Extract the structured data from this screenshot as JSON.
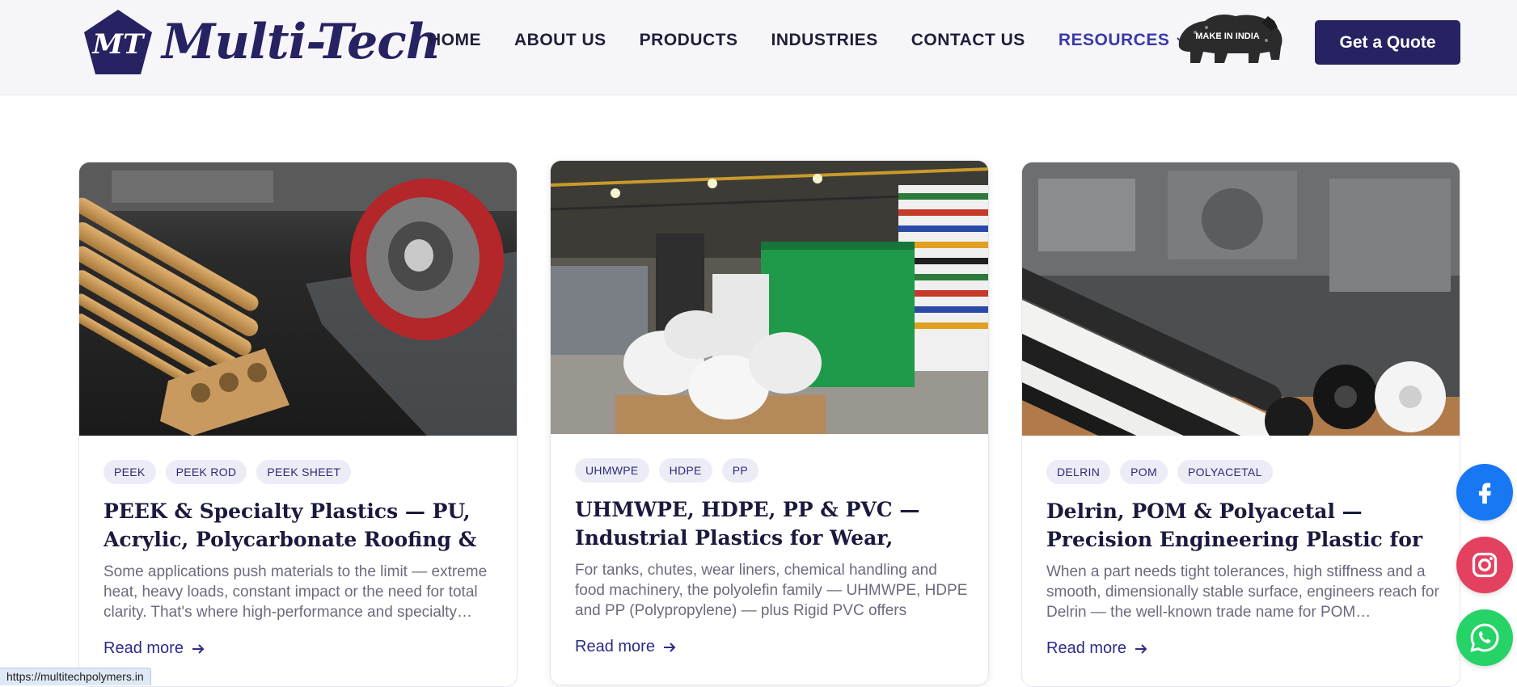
{
  "brand": {
    "name": "Multi-Tech",
    "mark": "MT",
    "color": "#272262"
  },
  "nav": {
    "items": [
      {
        "label": "HOME"
      },
      {
        "label": "ABOUT US"
      },
      {
        "label": "PRODUCTS"
      },
      {
        "label": "INDUSTRIES"
      },
      {
        "label": "CONTACT US"
      },
      {
        "label": "RESOURCES"
      }
    ],
    "active": "RESOURCES",
    "make_in_india": "MAKE IN INDIA"
  },
  "cta": {
    "label": "Get a Quote"
  },
  "cards": [
    {
      "tags": [
        "PEEK",
        "PEEK ROD",
        "PEEK SHEET"
      ],
      "title": "PEEK & Specialty Plastics — PU, Acrylic, Polycarbonate Roofing & High-…",
      "desc": "Some applications push materials to the limit — extreme heat, heavy loads, constant impact or the need for total clarity. That's where high-performance and specialty…",
      "read_more": "Read more"
    },
    {
      "tags": [
        "UHMWPE",
        "HDPE",
        "PP"
      ],
      "title": "UHMWPE, HDPE, PP & PVC — Industrial Plastics for Wear, Chemicals & Custom…",
      "desc": "For tanks, chutes, wear liners, chemical handling and food machinery, the polyolefin family — UHMWPE, HDPE and PP (Polypropylene) — plus Rigid PVC offers unbeatable value…",
      "read_more": "Read more"
    },
    {
      "tags": [
        "DELRIN",
        "POM",
        "POLYACETAL"
      ],
      "title": "Delrin, POM & Polyacetal — Precision Engineering Plastic for Machined Parts",
      "desc": "When a part needs tight tolerances, high stiffness and a smooth, dimensionally stable surface, engineers reach for Delrin — the well-known trade name for POM…",
      "read_more": "Read more"
    }
  ],
  "social": [
    {
      "icon": "facebook-icon",
      "color": "#1877f2"
    },
    {
      "icon": "instagram-icon",
      "color": "#e4405f"
    },
    {
      "icon": "whatsapp-icon",
      "color": "#25d366"
    }
  ],
  "status_url": "https://multitechpolymers.in"
}
